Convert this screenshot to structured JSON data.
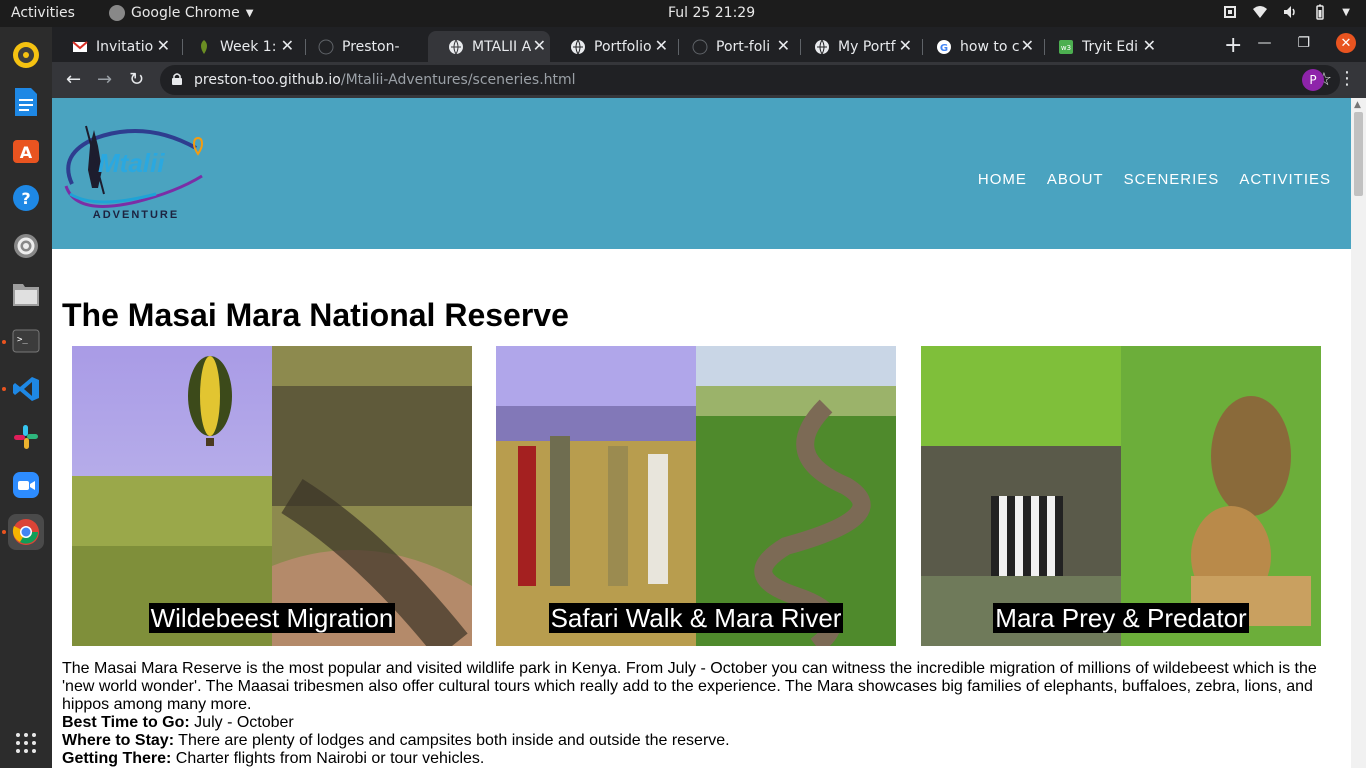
{
  "system": {
    "activities": "Activities",
    "app_name": "Google Chrome",
    "clock": "Ful 25  21:29"
  },
  "browser": {
    "tabs": [
      {
        "label": "Invitatio",
        "favicon": "gmail-icon"
      },
      {
        "label": "Week 1: ",
        "favicon": "leaf-icon"
      },
      {
        "label": "Preston-",
        "favicon": "github-icon"
      },
      {
        "label": "MTALII A",
        "favicon": "globe-icon",
        "active": true
      },
      {
        "label": "Portfolio",
        "favicon": "globe-icon"
      },
      {
        "label": "Port-foli",
        "favicon": "github-icon"
      },
      {
        "label": "My Portf",
        "favicon": "globe-icon"
      },
      {
        "label": "how to c",
        "favicon": "google-icon"
      },
      {
        "label": "Tryit Edi",
        "favicon": "w3schools-icon"
      }
    ],
    "url_host": "preston-too.github.io",
    "url_path": "/Mtalii-Adventures/sceneries.html",
    "profile_initial": "P"
  },
  "site": {
    "logo_text": "Mtalii",
    "logo_subtext": "ADVENTURE",
    "nav": [
      "HOME",
      "ABOUT",
      "SCENERIES",
      "ACTIVITIES"
    ],
    "title": "The Masai Mara National Reserve",
    "cards": [
      {
        "caption": "Wildebeest Migration"
      },
      {
        "caption": "Safari Walk & Mara River"
      },
      {
        "caption": "Mara Prey & Predator"
      }
    ],
    "description": "The Masai Mara Reserve is the most popular and visited wildlife park in Kenya. From July - October you can witness the incredible migration of millions of wildebeest which is the 'new world wonder'. The Maasai tribesmen also offer cultural tours which really add to the experience. The Mara showcases big families of elephants, buffaloes, zebra, lions, and hippos among many more.",
    "best_time_label": "Best Time to Go:",
    "best_time_value": " July - October",
    "stay_label": "Where to Stay:",
    "stay_value": " There are plenty of lodges and campsites both inside and outside the reserve.",
    "getting_label": "Getting There:",
    "getting_value": " Charter flights from Nairobi or tour vehicles."
  },
  "colors": {
    "header_bg": "#4aa3c0",
    "ubuntu_orange": "#e95420"
  }
}
